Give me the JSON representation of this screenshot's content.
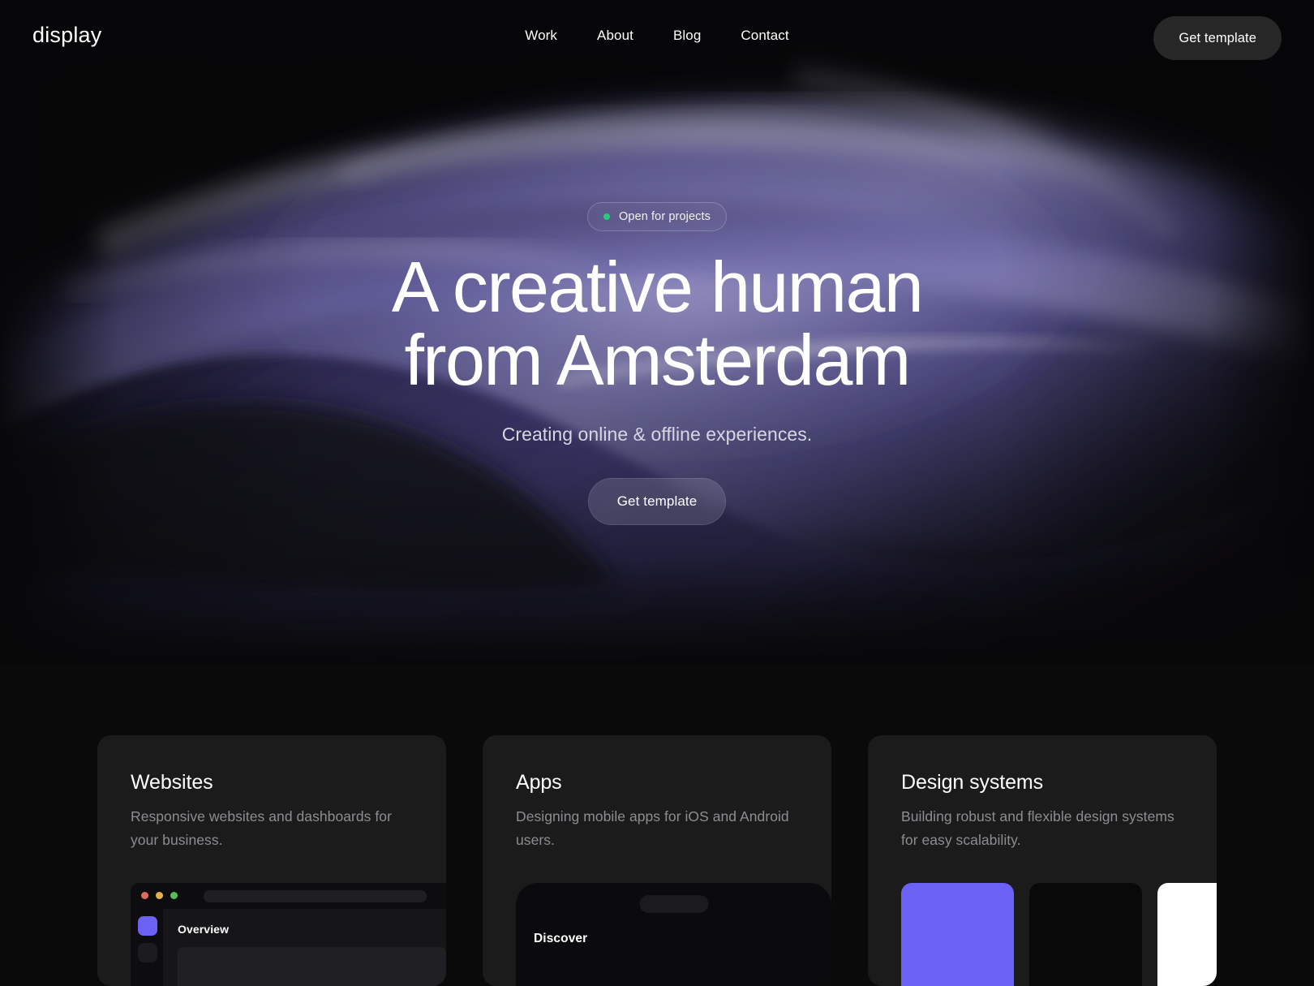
{
  "brand": {
    "logo": "display"
  },
  "nav": {
    "links": [
      {
        "label": "Work"
      },
      {
        "label": "About"
      },
      {
        "label": "Blog"
      },
      {
        "label": "Contact"
      }
    ],
    "cta_label": "Get template"
  },
  "hero": {
    "badge": {
      "label": "Open for projects",
      "dot_color": "#2dc77e"
    },
    "title_line1": "A creative human",
    "title_line2": "from Amsterdam",
    "subtitle": "Creating online & offline experiences.",
    "cta_label": "Get template"
  },
  "cards": [
    {
      "title": "Websites",
      "description": "Responsive websites and dashboards for your business.",
      "mockup": "browser",
      "browser": {
        "heading": "Overview"
      }
    },
    {
      "title": "Apps",
      "description": "Designing mobile apps for iOS and Android users.",
      "mockup": "phone",
      "phone": {
        "heading": "Discover"
      }
    },
    {
      "title": "Design systems",
      "description": "Building robust and flexible design systems for easy scalability.",
      "mockup": "swatches",
      "swatches": [
        "#6b62f5",
        "#09090a",
        "#ffffff"
      ]
    }
  ],
  "colors": {
    "background": "#0a0a0a",
    "card_background": "#1b1b1b",
    "accent_purple": "#6b62f5",
    "status_green": "#2dc77e",
    "text_primary": "#ffffff",
    "text_muted": "#8d8d93",
    "nav_cta_background": "#272727"
  }
}
